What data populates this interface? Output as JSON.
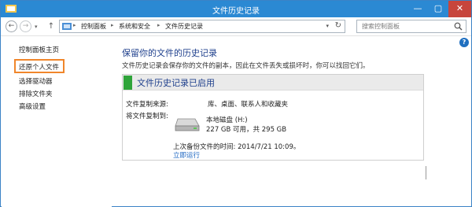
{
  "window": {
    "title": "文件历史记录",
    "minimize": "—",
    "maximize": "▢",
    "close": "✕"
  },
  "toolbar": {
    "back": "←",
    "forward": "→",
    "recent": "▾",
    "up": "↑"
  },
  "address": {
    "crumbs": [
      "控制面板",
      "系统和安全",
      "文件历史记录"
    ],
    "separator": "▸",
    "dropdown": "▾",
    "refresh": "↻"
  },
  "search": {
    "placeholder": "搜索控制面板"
  },
  "sidebar": {
    "home": "控制面板主页",
    "items": [
      {
        "label": "还原个人文件",
        "active": true
      },
      {
        "label": "选择驱动器"
      },
      {
        "label": "排除文件夹"
      },
      {
        "label": "高级设置"
      }
    ]
  },
  "help": "?",
  "main": {
    "title": "保留你的文件的历史记录",
    "description": "文件历史记录会保存你的文件的副本，因此在文件丢失或损坏时，你可以找回它们。"
  },
  "panel": {
    "title": "文件历史记录已启用",
    "status_color": "#2fa43a",
    "source_label": "文件复制来源:",
    "source_value": "库、桌面、联系人和收藏夹",
    "dest_label": "将文件复制到:",
    "drive_name": "本地磁盘 (H:)",
    "drive_space": "227 GB 可用，共 295 GB",
    "last_backup": "上次备份文件的时间: 2014/7/21 10:09。",
    "run_now": "立即运行"
  },
  "colors": {
    "titlebar": "#2b89d3",
    "accent_link": "#1a64c0",
    "heading": "#1e3f8c",
    "highlight": "#f0862b"
  }
}
